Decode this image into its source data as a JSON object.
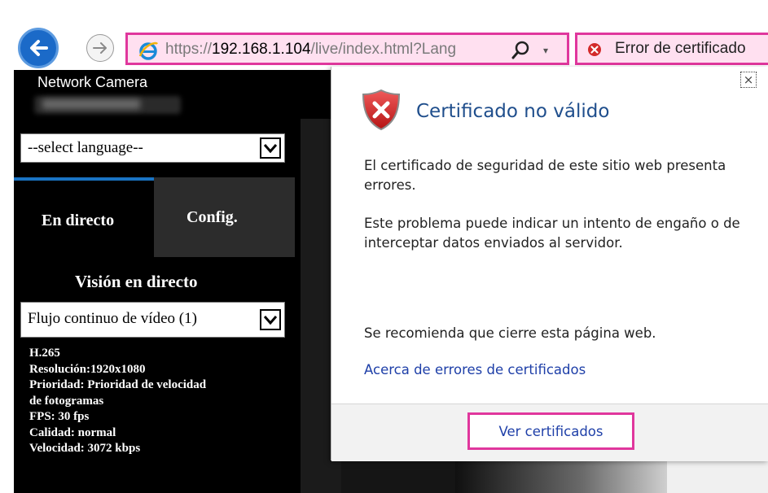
{
  "browser": {
    "url_prefix": "https://",
    "url_host": "192.168.1.104",
    "url_path": "/live/index.html?Lang",
    "dropdown_glyph": "▾",
    "cert_error_label": "Error de certificado"
  },
  "camera": {
    "title": "Network Camera",
    "language_select_value": "--select language--",
    "tabs": [
      {
        "label": "En directo",
        "active": true
      },
      {
        "label": "Config.",
        "active": false
      }
    ],
    "live_heading": "Visión en directo",
    "stream_select_value": "Flujo continuo de vídeo (1)",
    "stream_info": [
      "H.265",
      "Resolución:1920x1080",
      "Prioridad: Prioridad de velocidad",
      "de fotogramas",
      "FPS: 30 fps",
      "Calidad: normal",
      "Velocidad:  3072 kbps"
    ]
  },
  "popup": {
    "title": "Certificado no válido",
    "message1": "El certificado de seguridad de este sitio web presenta errores.",
    "message2": "Este problema puede indicar un intento de engaño o de interceptar datos enviados al servidor.",
    "message3": "Se recomienda que cierre esta página web.",
    "about_link": "Acerca de errores de certificados",
    "view_button": "Ver certificados",
    "close_glyph": "×"
  },
  "colors": {
    "highlight": "#e0379d",
    "link": "#1e3fa8",
    "title": "#1f4e8c",
    "error_red": "#d32a2a"
  }
}
